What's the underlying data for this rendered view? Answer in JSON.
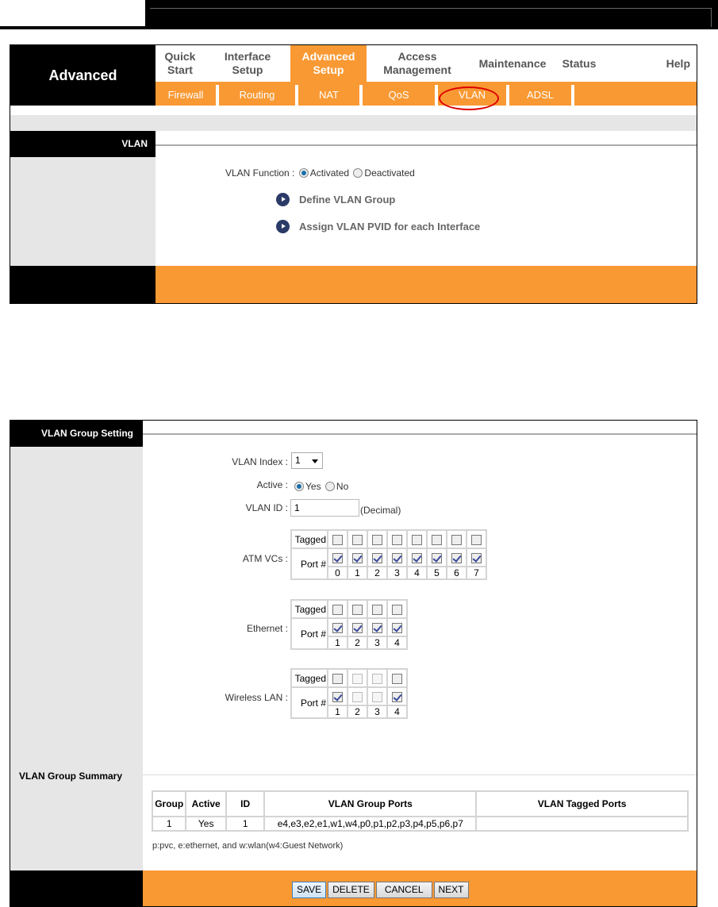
{
  "nav": {
    "brand": "Advanced",
    "main_tabs": [
      {
        "label": "Quick Start",
        "active": false
      },
      {
        "label": "Interface Setup",
        "active": false
      },
      {
        "label": "Advanced Setup",
        "active": true
      },
      {
        "label": "Access Management",
        "active": false
      },
      {
        "label": "Maintenance",
        "active": false
      },
      {
        "label": "Status",
        "active": false
      },
      {
        "label": "Help",
        "active": false
      }
    ],
    "sub_tabs": [
      "Firewall",
      "Routing",
      "NAT",
      "QoS",
      "VLAN",
      "ADSL"
    ],
    "highlighted_sub_tab": "VLAN"
  },
  "vlan_page": {
    "section_title": "VLAN",
    "function_label": "VLAN Function :",
    "options": [
      "Activated",
      "Deactivated"
    ],
    "selected": "Activated",
    "links": [
      "Define VLAN Group",
      "Assign VLAN PVID for each Interface"
    ]
  },
  "group_setting": {
    "section_title": "VLAN Group Setting",
    "index_label": "VLAN Index :",
    "index_value": "1",
    "active_label": "Active :",
    "active_options": [
      "Yes",
      "No"
    ],
    "active_selected": "Yes",
    "vlan_id_label": "VLAN ID :",
    "vlan_id_value": "1",
    "vlan_id_hint": "(Decimal)",
    "tagged_label": "Tagged",
    "port_label": "Port #",
    "groups": [
      {
        "label": "ATM VCs :",
        "ports": [
          "0",
          "1",
          "2",
          "3",
          "4",
          "5",
          "6",
          "7"
        ],
        "tagged": [
          false,
          false,
          false,
          false,
          false,
          false,
          false,
          false
        ],
        "member": [
          true,
          true,
          true,
          true,
          true,
          true,
          true,
          true
        ],
        "disabled": [
          false,
          false,
          false,
          false,
          false,
          false,
          false,
          false
        ]
      },
      {
        "label": "Ethernet :",
        "ports": [
          "1",
          "2",
          "3",
          "4"
        ],
        "tagged": [
          false,
          false,
          false,
          false
        ],
        "member": [
          true,
          true,
          true,
          true
        ],
        "disabled": [
          false,
          false,
          false,
          false
        ]
      },
      {
        "label": "Wireless LAN :",
        "ports": [
          "1",
          "2",
          "3",
          "4"
        ],
        "tagged": [
          false,
          false,
          false,
          false
        ],
        "member": [
          true,
          false,
          false,
          true
        ],
        "disabled": [
          false,
          true,
          true,
          false
        ]
      }
    ]
  },
  "summary": {
    "section_title": "VLAN Group Summary",
    "columns": [
      "Group",
      "Active",
      "ID",
      "VLAN Group Ports",
      "VLAN Tagged Ports"
    ],
    "rows": [
      [
        "1",
        "Yes",
        "1",
        "e4,e3,e2,e1,w1,w4,p0,p1,p2,p3,p4,p5,p6,p7",
        ""
      ]
    ],
    "legend": "p:pvc, e:ethernet, and w:wlan(w4:Guest Network)"
  },
  "buttons": {
    "save": "SAVE",
    "delete": "DELETE",
    "cancel": "CANCEL",
    "next": "NEXT"
  },
  "colors": {
    "accent": "#f99933",
    "header": "#000000",
    "sidebar": "#e6e6e6"
  }
}
